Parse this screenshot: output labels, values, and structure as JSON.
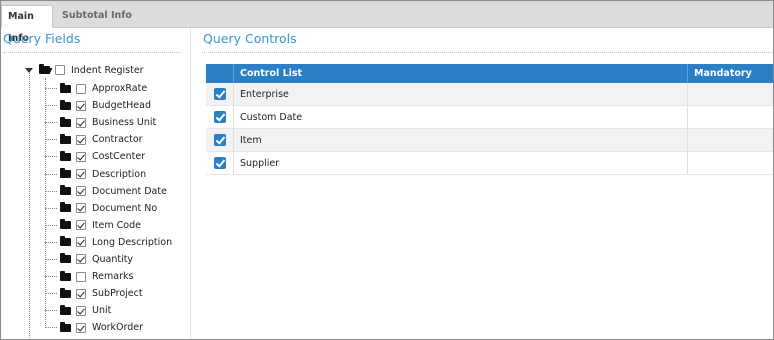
{
  "tabs": [
    {
      "label": "Main Info",
      "active": true
    },
    {
      "label": "Subtotal Info",
      "active": false
    }
  ],
  "query_fields": {
    "title": "Query Fields",
    "root": {
      "label": "Indent Register",
      "checked": false,
      "expanded": true
    },
    "items": [
      {
        "label": "ApproxRate",
        "checked": false
      },
      {
        "label": "BudgetHead",
        "checked": true
      },
      {
        "label": "Business Unit",
        "checked": true
      },
      {
        "label": "Contractor",
        "checked": true
      },
      {
        "label": "CostCenter",
        "checked": true
      },
      {
        "label": "Description",
        "checked": true
      },
      {
        "label": "Document Date",
        "checked": true
      },
      {
        "label": "Document No",
        "checked": true
      },
      {
        "label": "Item Code",
        "checked": true
      },
      {
        "label": "Long Description",
        "checked": true
      },
      {
        "label": "Quantity",
        "checked": true
      },
      {
        "label": "Remarks",
        "checked": false
      },
      {
        "label": "SubProject",
        "checked": true
      },
      {
        "label": "Unit",
        "checked": true
      },
      {
        "label": "WorkOrder",
        "checked": true
      }
    ]
  },
  "query_controls": {
    "title": "Query Controls",
    "columns": {
      "control_list": "Control List",
      "mandatory": "Mandatory"
    },
    "rows": [
      {
        "label": "Enterprise",
        "checked": true
      },
      {
        "label": "Custom Date",
        "checked": true
      },
      {
        "label": "Item",
        "checked": true
      },
      {
        "label": "Supplier",
        "checked": true
      }
    ]
  },
  "colors": {
    "accent": "#3b95d0",
    "header": "#2b7fc4"
  }
}
